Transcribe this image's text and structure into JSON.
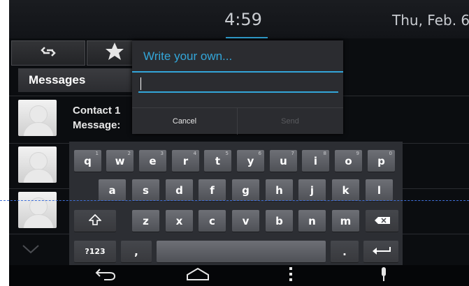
{
  "status_bar": {
    "time": "4:59",
    "date": "Thu, Feb. 6"
  },
  "tabs": [
    {
      "id": "threads",
      "icon": "contact-swap-icon"
    },
    {
      "id": "favorites",
      "icon": "star-icon"
    }
  ],
  "header": {
    "title": "Messages"
  },
  "conversations": [
    {
      "name": "Contact 1",
      "preview": "Message:"
    }
  ],
  "dialog": {
    "title": "Write your own...",
    "input_value": "",
    "cancel_label": "Cancel",
    "send_label": "Send"
  },
  "keyboard": {
    "row1": [
      "q",
      "w",
      "e",
      "r",
      "t",
      "y",
      "u",
      "i",
      "o",
      "p"
    ],
    "row1_hints": [
      "1",
      "2",
      "3",
      "4",
      "5",
      "6",
      "7",
      "8",
      "9",
      "0"
    ],
    "row2": [
      "a",
      "s",
      "d",
      "f",
      "g",
      "h",
      "j",
      "k",
      "l"
    ],
    "row3": [
      "z",
      "x",
      "c",
      "v",
      "b",
      "n",
      "m"
    ],
    "symbols_label": "?123",
    "comma": ",",
    "period": "."
  },
  "nav_icons": [
    "back-icon",
    "home-icon",
    "menu-icon",
    "mic-icon"
  ],
  "colors": {
    "accent": "#33a6d9",
    "background": "#0b0d10"
  }
}
